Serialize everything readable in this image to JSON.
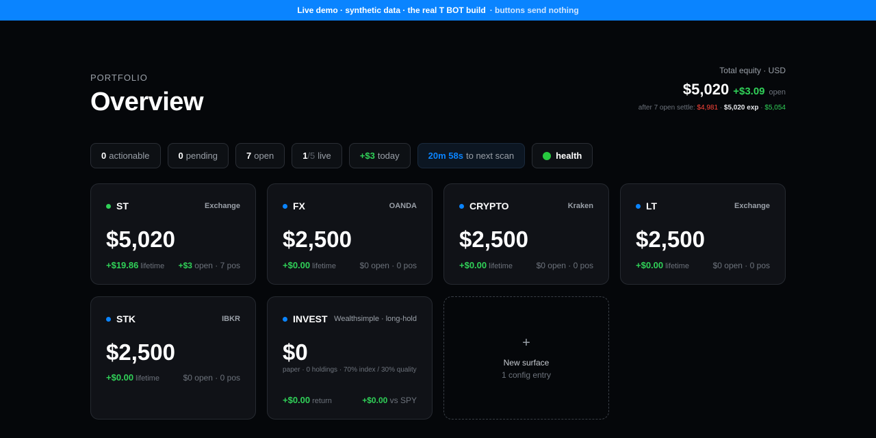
{
  "banner": {
    "main": "Live demo · synthetic data · the real T BOT build",
    "sub": "· buttons send nothing"
  },
  "header": {
    "eyebrow": "PORTFOLIO",
    "title": "Overview"
  },
  "equity": {
    "label": "Total equity · USD",
    "total": "$5,020",
    "delta": "+$3.09",
    "delta_suffix": "open",
    "settle_prefix": "after 7 open settle:",
    "settle_low": "$4,981",
    "settle_exp": "$5,020 exp",
    "settle_high": "$5,054"
  },
  "pills": [
    {
      "value": "0",
      "label": "actionable"
    },
    {
      "value": "0",
      "label": "pending"
    },
    {
      "value": "7",
      "label": "open"
    },
    {
      "value": "1",
      "sep": "/5",
      "label": "live"
    },
    {
      "value": "+$3",
      "label": "today"
    },
    {
      "value": "20m 58s",
      "label": "to next scan"
    },
    {
      "value": "health"
    }
  ],
  "cards": [
    {
      "name": "ST",
      "venue": "Exchange",
      "balance": "$5,020",
      "lifetime": "+$19.86",
      "lifetime_label": "lifetime",
      "open_value": "+$3",
      "open_rest": "open · 7 pos",
      "status_color": "#30d158"
    },
    {
      "name": "FX",
      "venue": "OANDA",
      "balance": "$2,500",
      "lifetime": "+$0.00",
      "lifetime_label": "lifetime",
      "open_rest": "$0 open · 0 pos",
      "status_color": "#0a84ff"
    },
    {
      "name": "CRYPTO",
      "venue": "Kraken",
      "balance": "$2,500",
      "lifetime": "+$0.00",
      "lifetime_label": "lifetime",
      "open_rest": "$0 open · 0 pos",
      "status_color": "#0a84ff"
    },
    {
      "name": "LT",
      "venue": "Exchange",
      "balance": "$2,500",
      "lifetime": "+$0.00",
      "lifetime_label": "lifetime",
      "open_rest": "$0 open · 0 pos",
      "status_color": "#0a84ff"
    },
    {
      "name": "STK",
      "venue": "IBKR",
      "balance": "$2,500",
      "lifetime": "+$0.00",
      "lifetime_label": "lifetime",
      "open_rest": "$0 open · 0 pos",
      "status_color": "#0a84ff"
    },
    {
      "name": "INVEST",
      "venue": "Wealthsimple · long-hold",
      "balance": "$0",
      "note": "paper · 0 holdings · 70% index / 30% quality",
      "lifetime": "+$0.00",
      "lifetime_label": "return",
      "vs_value": "+$0.00",
      "vs_label": "vs SPY",
      "status_color": "#0a84ff"
    }
  ],
  "new_surface": {
    "plus": "+",
    "title": "New surface",
    "subtitle": "1 config entry"
  }
}
